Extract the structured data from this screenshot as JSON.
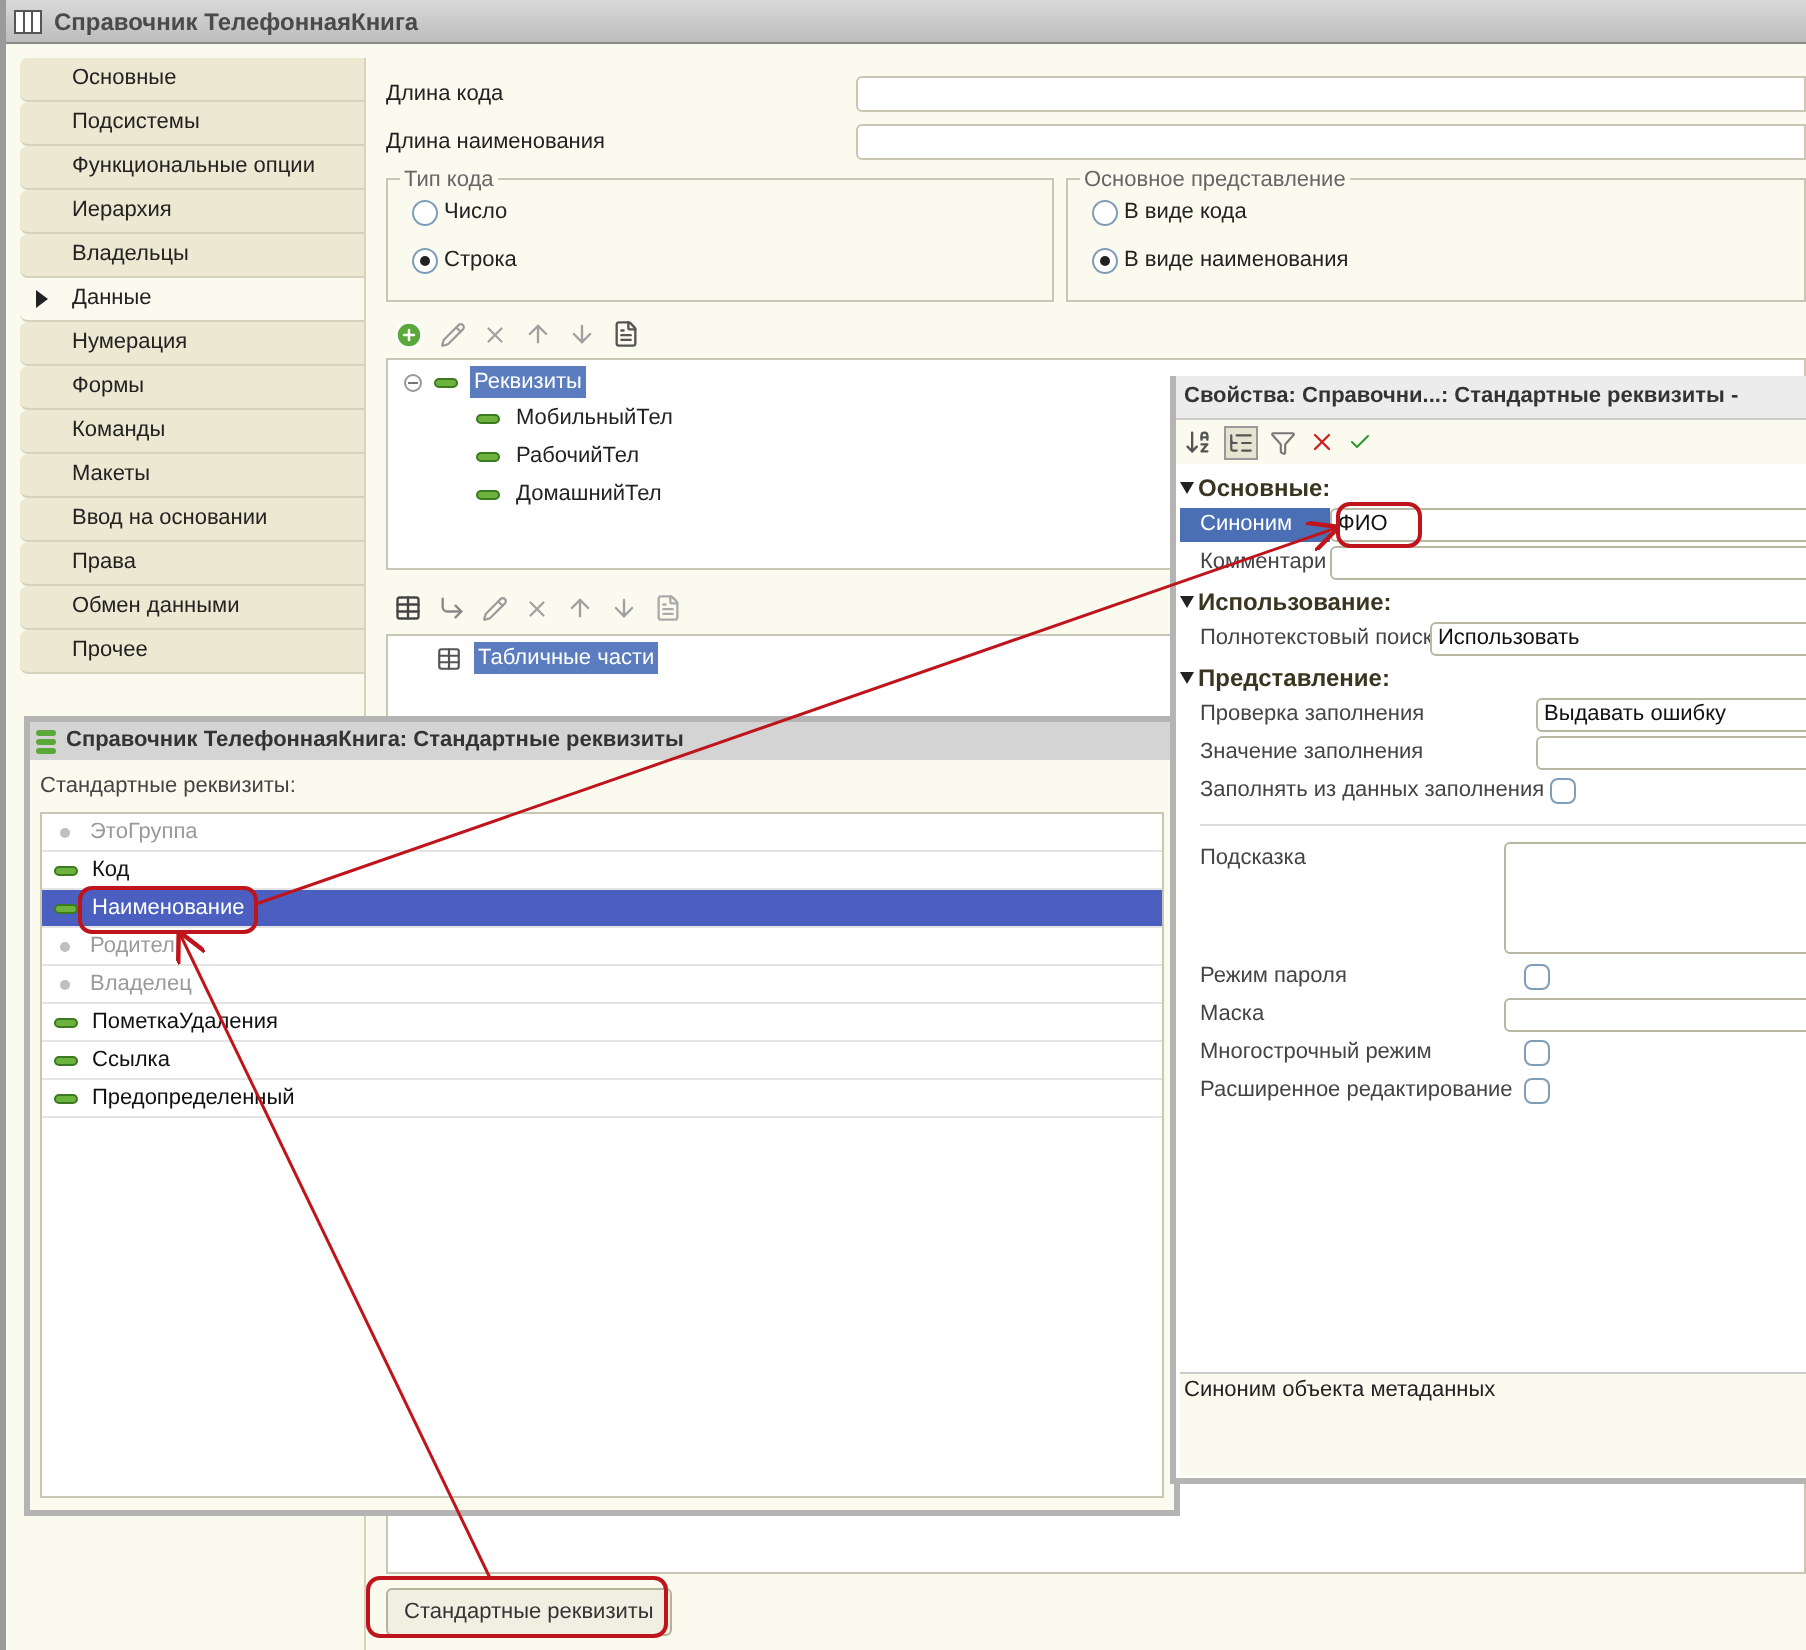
{
  "main_window": {
    "title": "Справочник ТелефоннаяКнига",
    "nav": [
      {
        "label": "Основные",
        "selected": false
      },
      {
        "label": "Подсистемы",
        "selected": false
      },
      {
        "label": "Функциональные опции",
        "selected": false
      },
      {
        "label": "Иерархия",
        "selected": false
      },
      {
        "label": "Владельцы",
        "selected": false
      },
      {
        "label": "Данные",
        "selected": true
      },
      {
        "label": "Нумерация",
        "selected": false
      },
      {
        "label": "Формы",
        "selected": false
      },
      {
        "label": "Команды",
        "selected": false
      },
      {
        "label": "Макеты",
        "selected": false
      },
      {
        "label": "Ввод на основании",
        "selected": false
      },
      {
        "label": "Права",
        "selected": false
      },
      {
        "label": "Обмен данными",
        "selected": false
      },
      {
        "label": "Прочее",
        "selected": false
      }
    ],
    "fields": [
      {
        "label": "Длина кода"
      },
      {
        "label": "Длина наименования"
      }
    ],
    "groups": [
      {
        "title": "Тип кода",
        "options": [
          {
            "label": "Число",
            "selected": false
          },
          {
            "label": "Строка",
            "selected": true
          }
        ]
      },
      {
        "title": "Основное представление",
        "options": [
          {
            "label": "В виде кода",
            "selected": false
          },
          {
            "label": "В виде наименования",
            "selected": true
          }
        ]
      }
    ],
    "attributes_tree": {
      "label": "Реквизиты",
      "expanded": true,
      "selected": true,
      "children": [
        {
          "label": "МобильныйТел"
        },
        {
          "label": "РабочийТел"
        },
        {
          "label": "ДомашнийТел"
        }
      ]
    },
    "tabular_tree": {
      "label": "Табличные части",
      "selected": true
    },
    "standard_button": "Стандартные реквизиты"
  },
  "standard_window": {
    "title": "Справочник ТелефоннаяКнига: Стандартные реквизиты",
    "list_label": "Стандартные реквизиты:",
    "items": [
      {
        "label": "ЭтоГруппа",
        "disabled": true,
        "selected": false
      },
      {
        "label": "Код",
        "disabled": false,
        "selected": false
      },
      {
        "label": "Наименование",
        "disabled": false,
        "selected": true
      },
      {
        "label": "Родител",
        "disabled": true,
        "selected": false
      },
      {
        "label": "Владелец",
        "disabled": true,
        "selected": false
      },
      {
        "label": "ПометкаУдаления",
        "disabled": false,
        "selected": false
      },
      {
        "label": "Ссылка",
        "disabled": false,
        "selected": false
      },
      {
        "label": "Предопределенный",
        "disabled": false,
        "selected": false
      }
    ]
  },
  "properties_window": {
    "title": "Свойства: Справочни...: Стандартные реквизиты -",
    "sections": [
      {
        "title": "Основные:",
        "expanded": true,
        "rows": [
          {
            "kind": "field",
            "label": "Синоним",
            "value": "ФИО",
            "selected": true
          },
          {
            "kind": "field",
            "label": "Комментари",
            "selected": false
          }
        ]
      },
      {
        "title": "Использование:",
        "expanded": true,
        "rows": [
          {
            "kind": "select",
            "label": "Полнотекстовый поиск",
            "value": "Использовать",
            "selected": false
          }
        ]
      },
      {
        "title": "Представление:",
        "expanded": true,
        "rows": [
          {
            "kind": "select",
            "label": "Проверка заполнения",
            "value": "Выдавать ошибку",
            "selected": false
          },
          {
            "kind": "field",
            "label": "Значение заполнения",
            "selected": false
          },
          {
            "kind": "checkbox",
            "label": "Заполнять из данных заполнения",
            "checked": false,
            "selected": false
          },
          {
            "kind": "divider"
          },
          {
            "kind": "textarea",
            "label": "Подсказка",
            "selected": false
          },
          {
            "kind": "checkbox",
            "label": "Режим пароля",
            "checked": false,
            "selected": false
          },
          {
            "kind": "field",
            "label": "Маска",
            "selected": false
          },
          {
            "kind": "checkbox",
            "label": "Многострочный режим",
            "checked": false,
            "selected": false
          },
          {
            "kind": "checkbox",
            "label": "Расширенное редактирование",
            "checked": false,
            "selected": false
          }
        ]
      }
    ],
    "description": "Синоним объекта метаданных"
  }
}
